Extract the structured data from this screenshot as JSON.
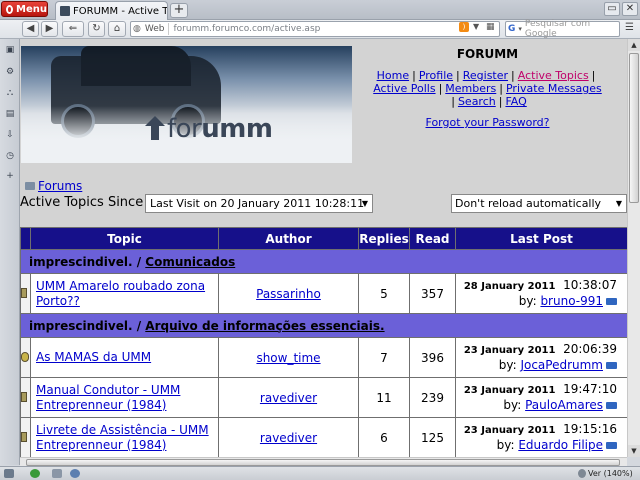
{
  "browser": {
    "menu_label": "Menu",
    "tab_title": "FORUMM - Active Top...",
    "tab_close": "×",
    "new_tab": "+",
    "address": {
      "prefix": "Web",
      "url": "forumm.forumco.com/active.asp"
    },
    "search_placeholder": "Pesquisar com Google",
    "search_engine": "G",
    "status_zoom": "Ver (140%)"
  },
  "forum": {
    "logo_text_light": "for",
    "logo_text_bold": "umm",
    "title": "FORUMM",
    "nav": {
      "home": "Home",
      "profile": "Profile",
      "register": "Register",
      "active_topics": "Active Topics",
      "active_polls": "Active Polls",
      "members": "Members",
      "private_messages": "Private Messages",
      "search": "Search",
      "faq": "FAQ",
      "separator": "|"
    },
    "forgot_password": "Forgot your Password?",
    "breadcrumb": "Forums",
    "active_since_label": "Active Topics Since",
    "since_value": "Last Visit on 20 January 2011 10:28:11",
    "reload_value": "Don't reload automatically"
  },
  "table": {
    "headers": {
      "topic": "Topic",
      "author": "Author",
      "replies": "Replies",
      "read": "Read",
      "last_post": "Last Post"
    },
    "sections": [
      {
        "category": "imprescindivel.",
        "sep": "/",
        "forum": "Comunicados",
        "rows": [
          {
            "topic": "UMM Amarelo roubado zona Porto??",
            "author": "Passarinho",
            "replies": "5",
            "read": "357",
            "date": "28 January 2011",
            "time": "10:38:07",
            "by_label": "by:",
            "by": "bruno-991",
            "hot": false
          }
        ]
      },
      {
        "category": "imprescindivel.",
        "sep": "/",
        "forum": "Arquivo de informações essenciais.",
        "rows": [
          {
            "topic": "As MAMAS da UMM",
            "author": "show_time",
            "replies": "7",
            "read": "396",
            "date": "23 January 2011",
            "time": "20:06:39",
            "by_label": "by:",
            "by": "JocaPedrumm",
            "hot": true
          },
          {
            "topic": "Manual Condutor - UMM Entreprenneur (1984)",
            "author": "ravediver",
            "replies": "11",
            "read": "239",
            "date": "23 January 2011",
            "time": "19:47:10",
            "by_label": "by:",
            "by": "PauloAmares",
            "hot": false
          },
          {
            "topic": "Livrete de Assistência - UMM Entreprenneur (1984)",
            "author": "ravediver",
            "replies": "6",
            "read": "125",
            "date": "23 January 2011",
            "time": "19:15:16",
            "by_label": "by:",
            "by": "Eduardo Filipe",
            "hot": false
          }
        ]
      }
    ]
  }
}
